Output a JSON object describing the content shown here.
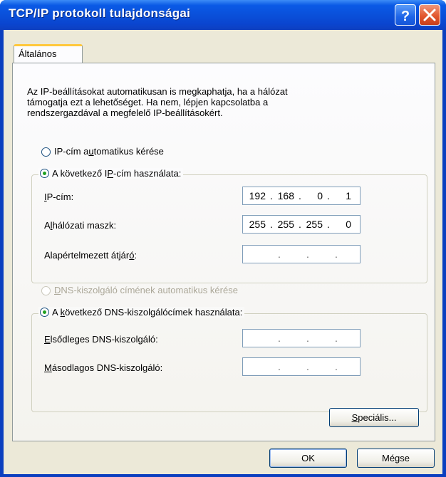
{
  "window": {
    "title": "TCP/IP protokoll tulajdonságai",
    "help_icon": "question-mark-icon",
    "close_icon": "close-x-icon"
  },
  "tabs": [
    {
      "label": "Általános",
      "selected": true
    }
  ],
  "description": [
    "Az IP-beállításokat automatikusan is megkaphatja, ha a hálózat",
    "támogatja ezt a lehetőséget. Ha nem, lépjen kapcsolatba a",
    "rendszergazdával a megfelelő IP-beállításokért."
  ],
  "ip_section": {
    "auto_option": {
      "pre": "IP-cím a",
      "u": "u",
      "post": "tomatikus kérése",
      "checked": false
    },
    "manual_option": {
      "pre": "A következő I",
      "u": "P",
      "post": "-cím használata:",
      "checked": true
    },
    "fields": [
      {
        "label_u": "I",
        "label_rest": "P-cím:",
        "octets": [
          "192",
          "168",
          "0",
          "1"
        ]
      },
      {
        "label_pre": "A",
        "label_u": "l",
        "label_rest": "hálózati maszk:",
        "octets": [
          "255",
          "255",
          "255",
          "0"
        ]
      },
      {
        "label_pre": "Alapértelmezett átjár",
        "label_u": "ó",
        "label_rest": ":",
        "octets": [
          "",
          "",
          "",
          ""
        ]
      }
    ]
  },
  "dns_section": {
    "auto_option": {
      "u": "D",
      "post": "NS-kiszolgáló címének automatikus kérése",
      "checked": false,
      "disabled": true
    },
    "manual_option": {
      "pre": "A ",
      "u": "k",
      "post": "övetkező DNS-kiszolgálócímek használata:",
      "checked": true
    },
    "fields": [
      {
        "label_u": "E",
        "label_rest": "lsődleges DNS-kiszolgáló:",
        "octets": [
          "",
          "",
          "",
          ""
        ]
      },
      {
        "label_u": "M",
        "label_rest": "ásodlagos DNS-kiszolgáló:",
        "octets": [
          "",
          "",
          "",
          ""
        ]
      }
    ]
  },
  "buttons": {
    "advanced": {
      "u": "S",
      "rest": "peciális..."
    },
    "ok": "OK",
    "cancel": "Mégse"
  },
  "colors": {
    "titlebar": "#0a4ed8",
    "dialog_bg": "#ece9d8",
    "tab_accent": "#ffc83c",
    "radio_dot": "#21a121"
  }
}
